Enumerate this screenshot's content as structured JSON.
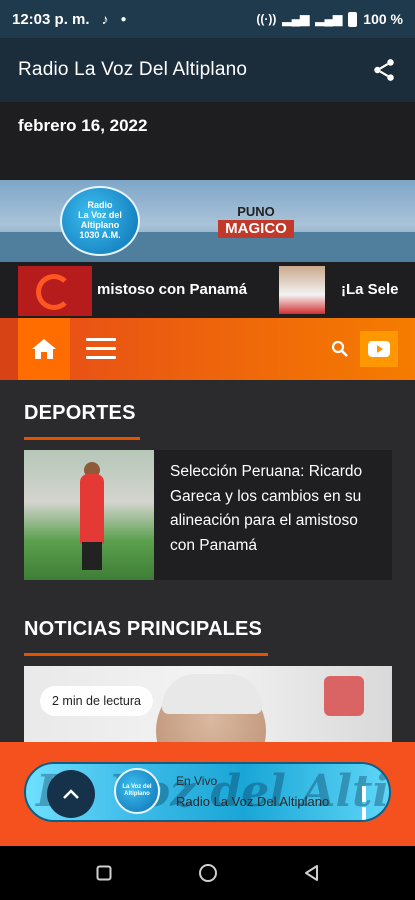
{
  "status_bar": {
    "time": "12:03 p. m.",
    "battery": "100 %"
  },
  "app_bar": {
    "title": "Radio La Voz Del Altiplano",
    "share_icon": "share-icon"
  },
  "date": "febrero 16, 2022",
  "banner": {
    "logo_lines": [
      "Radio",
      "La Voz del Altiplano",
      "1030 A.M."
    ],
    "puno_top": "PUNO",
    "puno_bottom": "MAGICO"
  },
  "ticker": [
    {
      "text": "mistoso con Panamá"
    },
    {
      "text": "¡La Sele"
    }
  ],
  "nav": {
    "home_icon": "home-icon",
    "menu_icon": "menu-icon",
    "search_icon": "search-icon",
    "youtube_icon": "youtube-icon"
  },
  "sections": {
    "deportes": {
      "title": "DEPORTES",
      "article_headline": "Selección Peruana: Ricardo Gareca y los cambios en su alineación para el amistoso con Panamá"
    },
    "noticias": {
      "title": "NOTICIAS PRINCIPALES",
      "reading_time": "2 min de lectura"
    }
  },
  "player": {
    "status": "En Vivo",
    "station": "Radio La Voz Del Altiplano",
    "background_text": "La Voz del Altiplano",
    "logo_text": "La Voz del Altiplano"
  },
  "colors": {
    "accent": "#f4511e",
    "appbar": "#1b2c3b",
    "statusbar": "#1f3a4d"
  }
}
